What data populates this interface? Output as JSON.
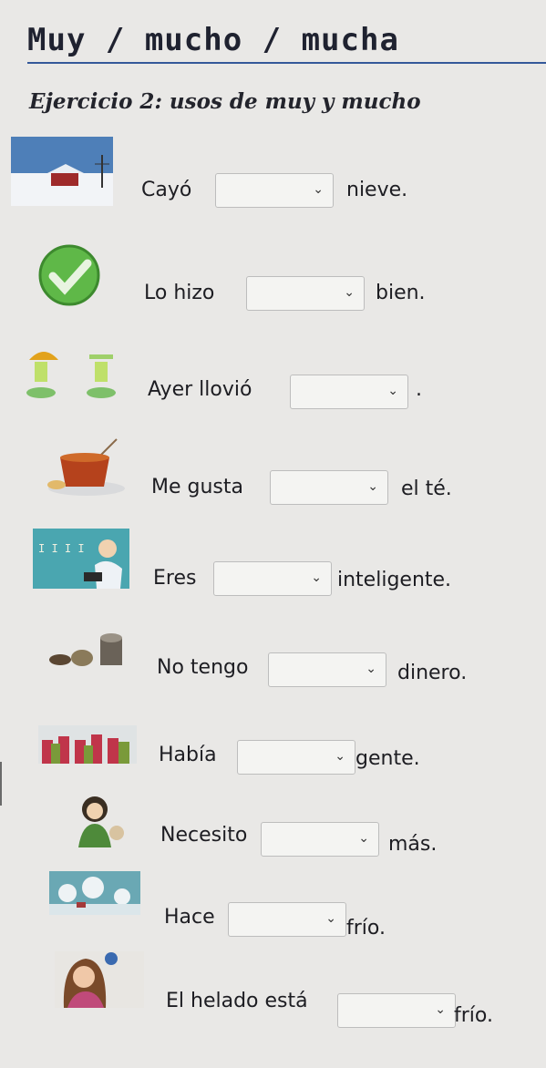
{
  "header": {
    "title": "Muy / mucho / mucha",
    "subtitle": "Ejercicio 2: usos de muy y mucho"
  },
  "dropdown": {
    "chevron": "⌄",
    "chevron_icon": "chevron-down-icon"
  },
  "exercises": [
    {
      "icon": "snowy-landscape-icon",
      "before": "Cayó",
      "after": "nieve."
    },
    {
      "icon": "green-checkmark-icon",
      "before": "Lo hizo",
      "after": "bien."
    },
    {
      "icon": "rain-umbrella-icon",
      "before": "Ayer llovió",
      "after": "."
    },
    {
      "icon": "tea-cup-icon",
      "before": "Me gusta",
      "after": "el té."
    },
    {
      "icon": "teacher-board-icon",
      "before": "Eres",
      "after": "inteligente."
    },
    {
      "icon": "coins-icon",
      "before": "No tengo",
      "after": "dinero."
    },
    {
      "icon": "crowd-icon",
      "before": "Había",
      "after": "gente."
    },
    {
      "icon": "person-thinking-icon",
      "before": "Necesito",
      "after": "más."
    },
    {
      "icon": "snowy-trees-icon",
      "before": "Hace",
      "after": "frío."
    },
    {
      "icon": "ice-cream-girl-icon",
      "before": "El helado está",
      "after": "frío."
    }
  ]
}
